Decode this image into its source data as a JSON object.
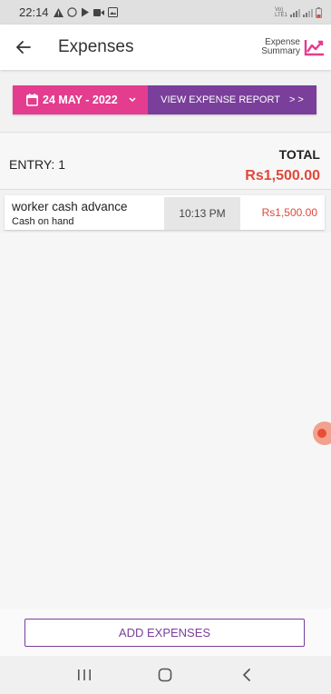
{
  "status_bar": {
    "time": "22:14",
    "carrier_line1": "Vo)",
    "carrier_line2": "LTE1"
  },
  "app_bar": {
    "title": "Expenses",
    "summary_line1": "Expense",
    "summary_line2": "Summary"
  },
  "actions": {
    "date_label": "24 MAY - 2022",
    "report_label": "VIEW EXPENSE REPORT",
    "report_arrows": "> >"
  },
  "summary": {
    "entry_label": "ENTRY: 1",
    "total_label": "TOTAL",
    "total_value": "Rs1,500.00"
  },
  "entries": [
    {
      "name": "worker cash advance",
      "method": "Cash on hand",
      "time": "10:13 PM",
      "amount": "Rs1,500.00"
    }
  ],
  "footer": {
    "add_label": "ADD EXPENSES"
  },
  "colors": {
    "accent_pink": "#e43c8e",
    "accent_purple": "#7a3f9a",
    "amount_red": "#e0483b"
  },
  "icons": [
    "back-arrow-icon",
    "chart-trend-icon",
    "calendar-icon",
    "chevron-down-icon",
    "recent-apps-icon",
    "home-icon",
    "nav-back-icon"
  ]
}
